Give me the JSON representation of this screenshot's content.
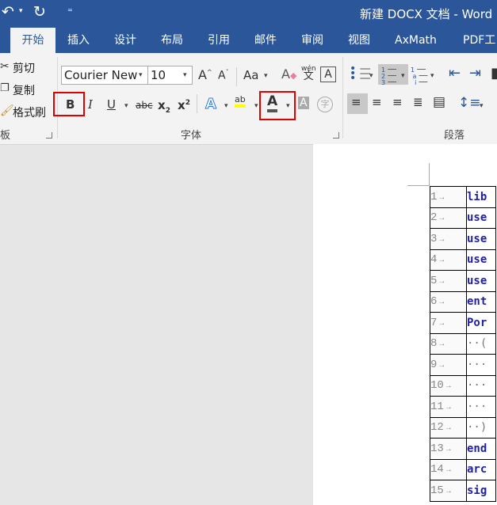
{
  "title_bar": {
    "undo": "↶",
    "redo": "↻",
    "qat_more": "⁼",
    "title": "新建 DOCX 文档 - Word"
  },
  "tabs": [
    "开始",
    "插入",
    "设计",
    "布局",
    "引用",
    "邮件",
    "审阅",
    "视图",
    "AxMath",
    "PDF工"
  ],
  "clipboard": {
    "cut": "剪切",
    "copy": "复制",
    "format_painter": "格式刷",
    "group_label": "板"
  },
  "font": {
    "name": "Courier New",
    "size": "10",
    "group_label": "字体",
    "grow": "A",
    "shrink": "A",
    "case": "Aa",
    "pinyin": "wén",
    "bold": "B",
    "italic": "I",
    "underline": "U",
    "strike": "abc",
    "subscript": "x",
    "subscript_mark": "2",
    "superscript": "x",
    "superscript_mark": "2",
    "effects": "A",
    "highlight": "ab",
    "font_color": "A",
    "shading": "A",
    "enclose": "字",
    "accent_color": "#2b579a",
    "highlight_color": "#ffff00",
    "font_color_bar": "#555555"
  },
  "paragraph": {
    "group_label": "段落"
  },
  "document": {
    "lines": [
      {
        "n": "1",
        "arrow": "→",
        "code": "lib",
        "style": "kw"
      },
      {
        "n": "2",
        "arrow": "→",
        "code": "use",
        "style": "kw"
      },
      {
        "n": "3",
        "arrow": "→",
        "code": "use",
        "style": "kw"
      },
      {
        "n": "4",
        "arrow": "→",
        "code": "use",
        "style": "kw"
      },
      {
        "n": "5",
        "arrow": "→",
        "code": "use",
        "style": "kw"
      },
      {
        "n": "6",
        "arrow": "→",
        "code": "ent",
        "style": "kw"
      },
      {
        "n": "7",
        "arrow": "→",
        "code": "Por",
        "style": "kw"
      },
      {
        "n": "8",
        "arrow": "→",
        "code": "··(",
        "style": "dot"
      },
      {
        "n": "9",
        "arrow": "→",
        "code": "···",
        "style": "dot"
      },
      {
        "n": "10",
        "arrow": "→",
        "code": "···",
        "style": "dot"
      },
      {
        "n": "11",
        "arrow": "→",
        "code": "···",
        "style": "dot"
      },
      {
        "n": "12",
        "arrow": "→",
        "code": "··)",
        "style": "dot"
      },
      {
        "n": "13",
        "arrow": "→",
        "code": "end",
        "style": "kw"
      },
      {
        "n": "14",
        "arrow": "→",
        "code": "arc",
        "style": "kw"
      },
      {
        "n": "15",
        "arrow": "→",
        "code": "sig",
        "style": "kw"
      }
    ]
  }
}
